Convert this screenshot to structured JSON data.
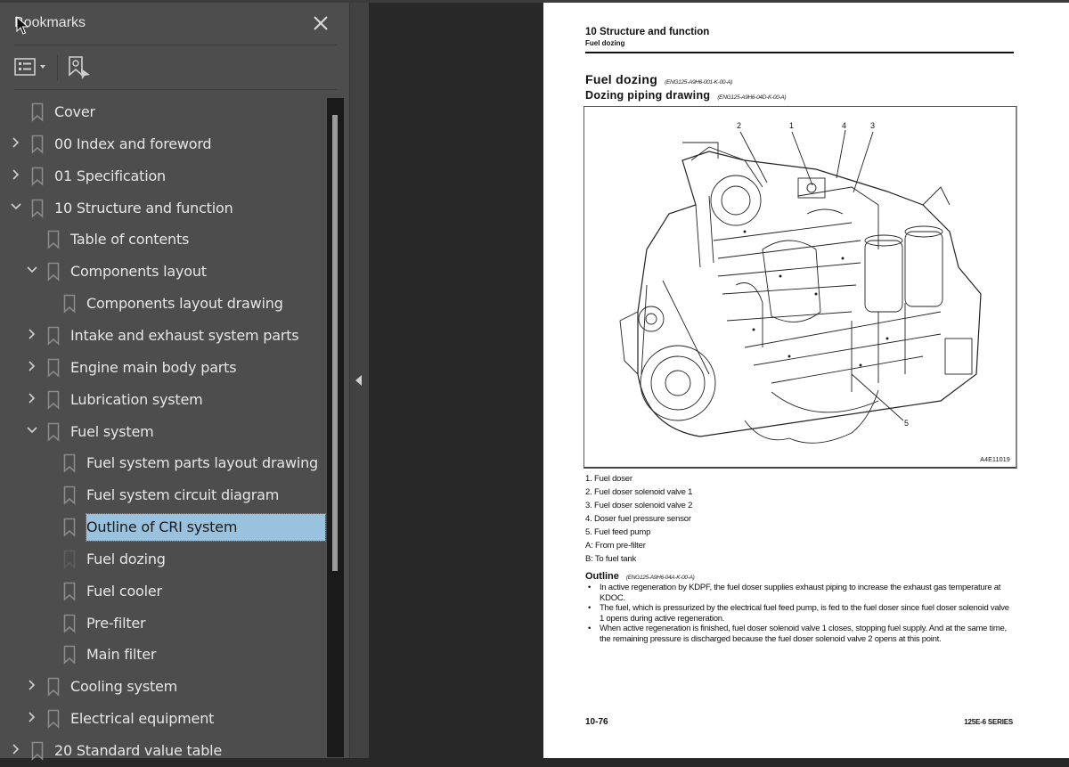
{
  "bookmarks_panel": {
    "title": "Bookmarks",
    "close_icon": "close-icon",
    "toolbar": {
      "options_icon": "list-options-icon",
      "find_icon": "find-current-bookmark-icon"
    },
    "items": [
      {
        "label": "Cover",
        "level": 0,
        "expander": "none"
      },
      {
        "label": "00 Index and foreword",
        "level": 0,
        "expander": "collapsed"
      },
      {
        "label": "01 Specification",
        "level": 0,
        "expander": "collapsed"
      },
      {
        "label": "10 Structure and function",
        "level": 0,
        "expander": "expanded"
      },
      {
        "label": "Table of contents",
        "level": 1,
        "expander": "none"
      },
      {
        "label": "Components layout",
        "level": 1,
        "expander": "expanded"
      },
      {
        "label": "Components layout drawing",
        "level": 2,
        "expander": "none"
      },
      {
        "label": "Intake and exhaust system parts",
        "level": 1,
        "expander": "collapsed"
      },
      {
        "label": "Engine main body parts",
        "level": 1,
        "expander": "collapsed"
      },
      {
        "label": "Lubrication system",
        "level": 1,
        "expander": "collapsed"
      },
      {
        "label": "Fuel system",
        "level": 1,
        "expander": "expanded"
      },
      {
        "label": "Fuel system parts layout drawing",
        "level": 2,
        "expander": "none"
      },
      {
        "label": "Fuel system circuit diagram",
        "level": 2,
        "expander": "none"
      },
      {
        "label": "Outline of CRI system",
        "level": 2,
        "expander": "none",
        "selected": true
      },
      {
        "label": "Fuel dozing",
        "level": 2,
        "expander": "none",
        "dim_icon": true
      },
      {
        "label": "Fuel cooler",
        "level": 2,
        "expander": "none"
      },
      {
        "label": "Pre-filter",
        "level": 2,
        "expander": "none"
      },
      {
        "label": "Main filter",
        "level": 2,
        "expander": "none"
      },
      {
        "label": "Cooling system",
        "level": 1,
        "expander": "collapsed"
      },
      {
        "label": "Electrical equipment",
        "level": 1,
        "expander": "collapsed"
      },
      {
        "label": "20 Standard value table",
        "level": 0,
        "expander": "collapsed"
      }
    ],
    "scroll_position": 0.03,
    "collapse_icon": "collapse-panel-arrow-icon"
  },
  "document": {
    "header_title": "10 Structure and function",
    "header_subtitle": "Fuel dozing",
    "heading1": "Fuel dozing",
    "heading1_code": "(ENG125-A9H6-001-K-00-A)",
    "heading2": "Dozing piping drawing",
    "heading2_code": "(ENG125-A9H6-04D-K-00-A)",
    "figure": {
      "id": "A4E11019",
      "callouts": [
        "2",
        "1",
        "4",
        "3",
        "5"
      ]
    },
    "legend": [
      "1. Fuel doser",
      "2. Fuel doser solenoid valve 1",
      "3. Fuel doser solenoid valve 2",
      "4. Doser fuel pressure sensor",
      "5. Fuel feed pump",
      "A: From pre-filter",
      "B: To fuel tank"
    ],
    "outline_title": "Outline",
    "outline_code": "(ENG125-A9H6-04A-K-00-A)",
    "outline_bullets": [
      "In active regeneration by KDPF, the fuel doser supplies exhaust piping to increase the exhaust gas temperature at KDOC.",
      "The fuel, which is pressurized by the electrical fuel feed pump, is fed to the fuel doser since fuel doser solenoid valve 1 opens during active regeneration.",
      "When active regeneration is finished, fuel doser solenoid valve 1 closes, stopping fuel supply. And at the same time, the remaining pressure is discharged because the fuel doser solenoid valve 2 opens at this point."
    ],
    "page_number": "10-76",
    "series": "125E-6 SERIES"
  },
  "colors": {
    "panel_bg": "#4d4d4d",
    "viewer_bg": "#282828",
    "selection": "#99c2de",
    "text": "#e6e6e6"
  }
}
